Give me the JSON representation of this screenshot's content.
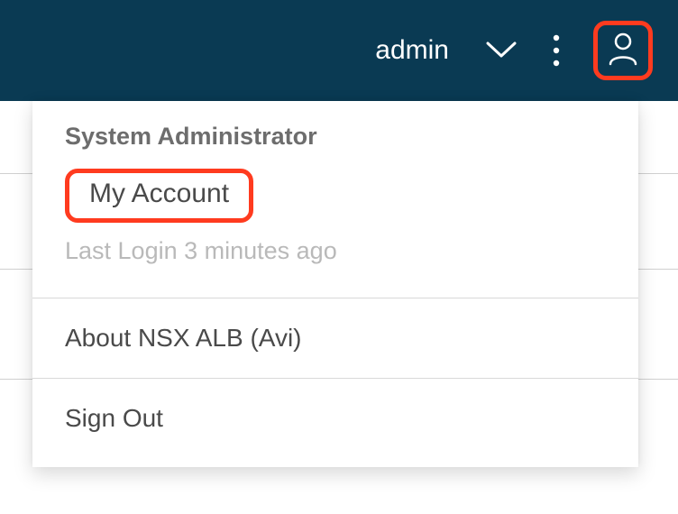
{
  "topbar": {
    "username": "admin"
  },
  "menu": {
    "role": "System Administrator",
    "my_account": "My Account",
    "last_login": "Last Login 3 minutes ago",
    "about": "About NSX ALB (Avi)",
    "sign_out": "Sign Out"
  }
}
